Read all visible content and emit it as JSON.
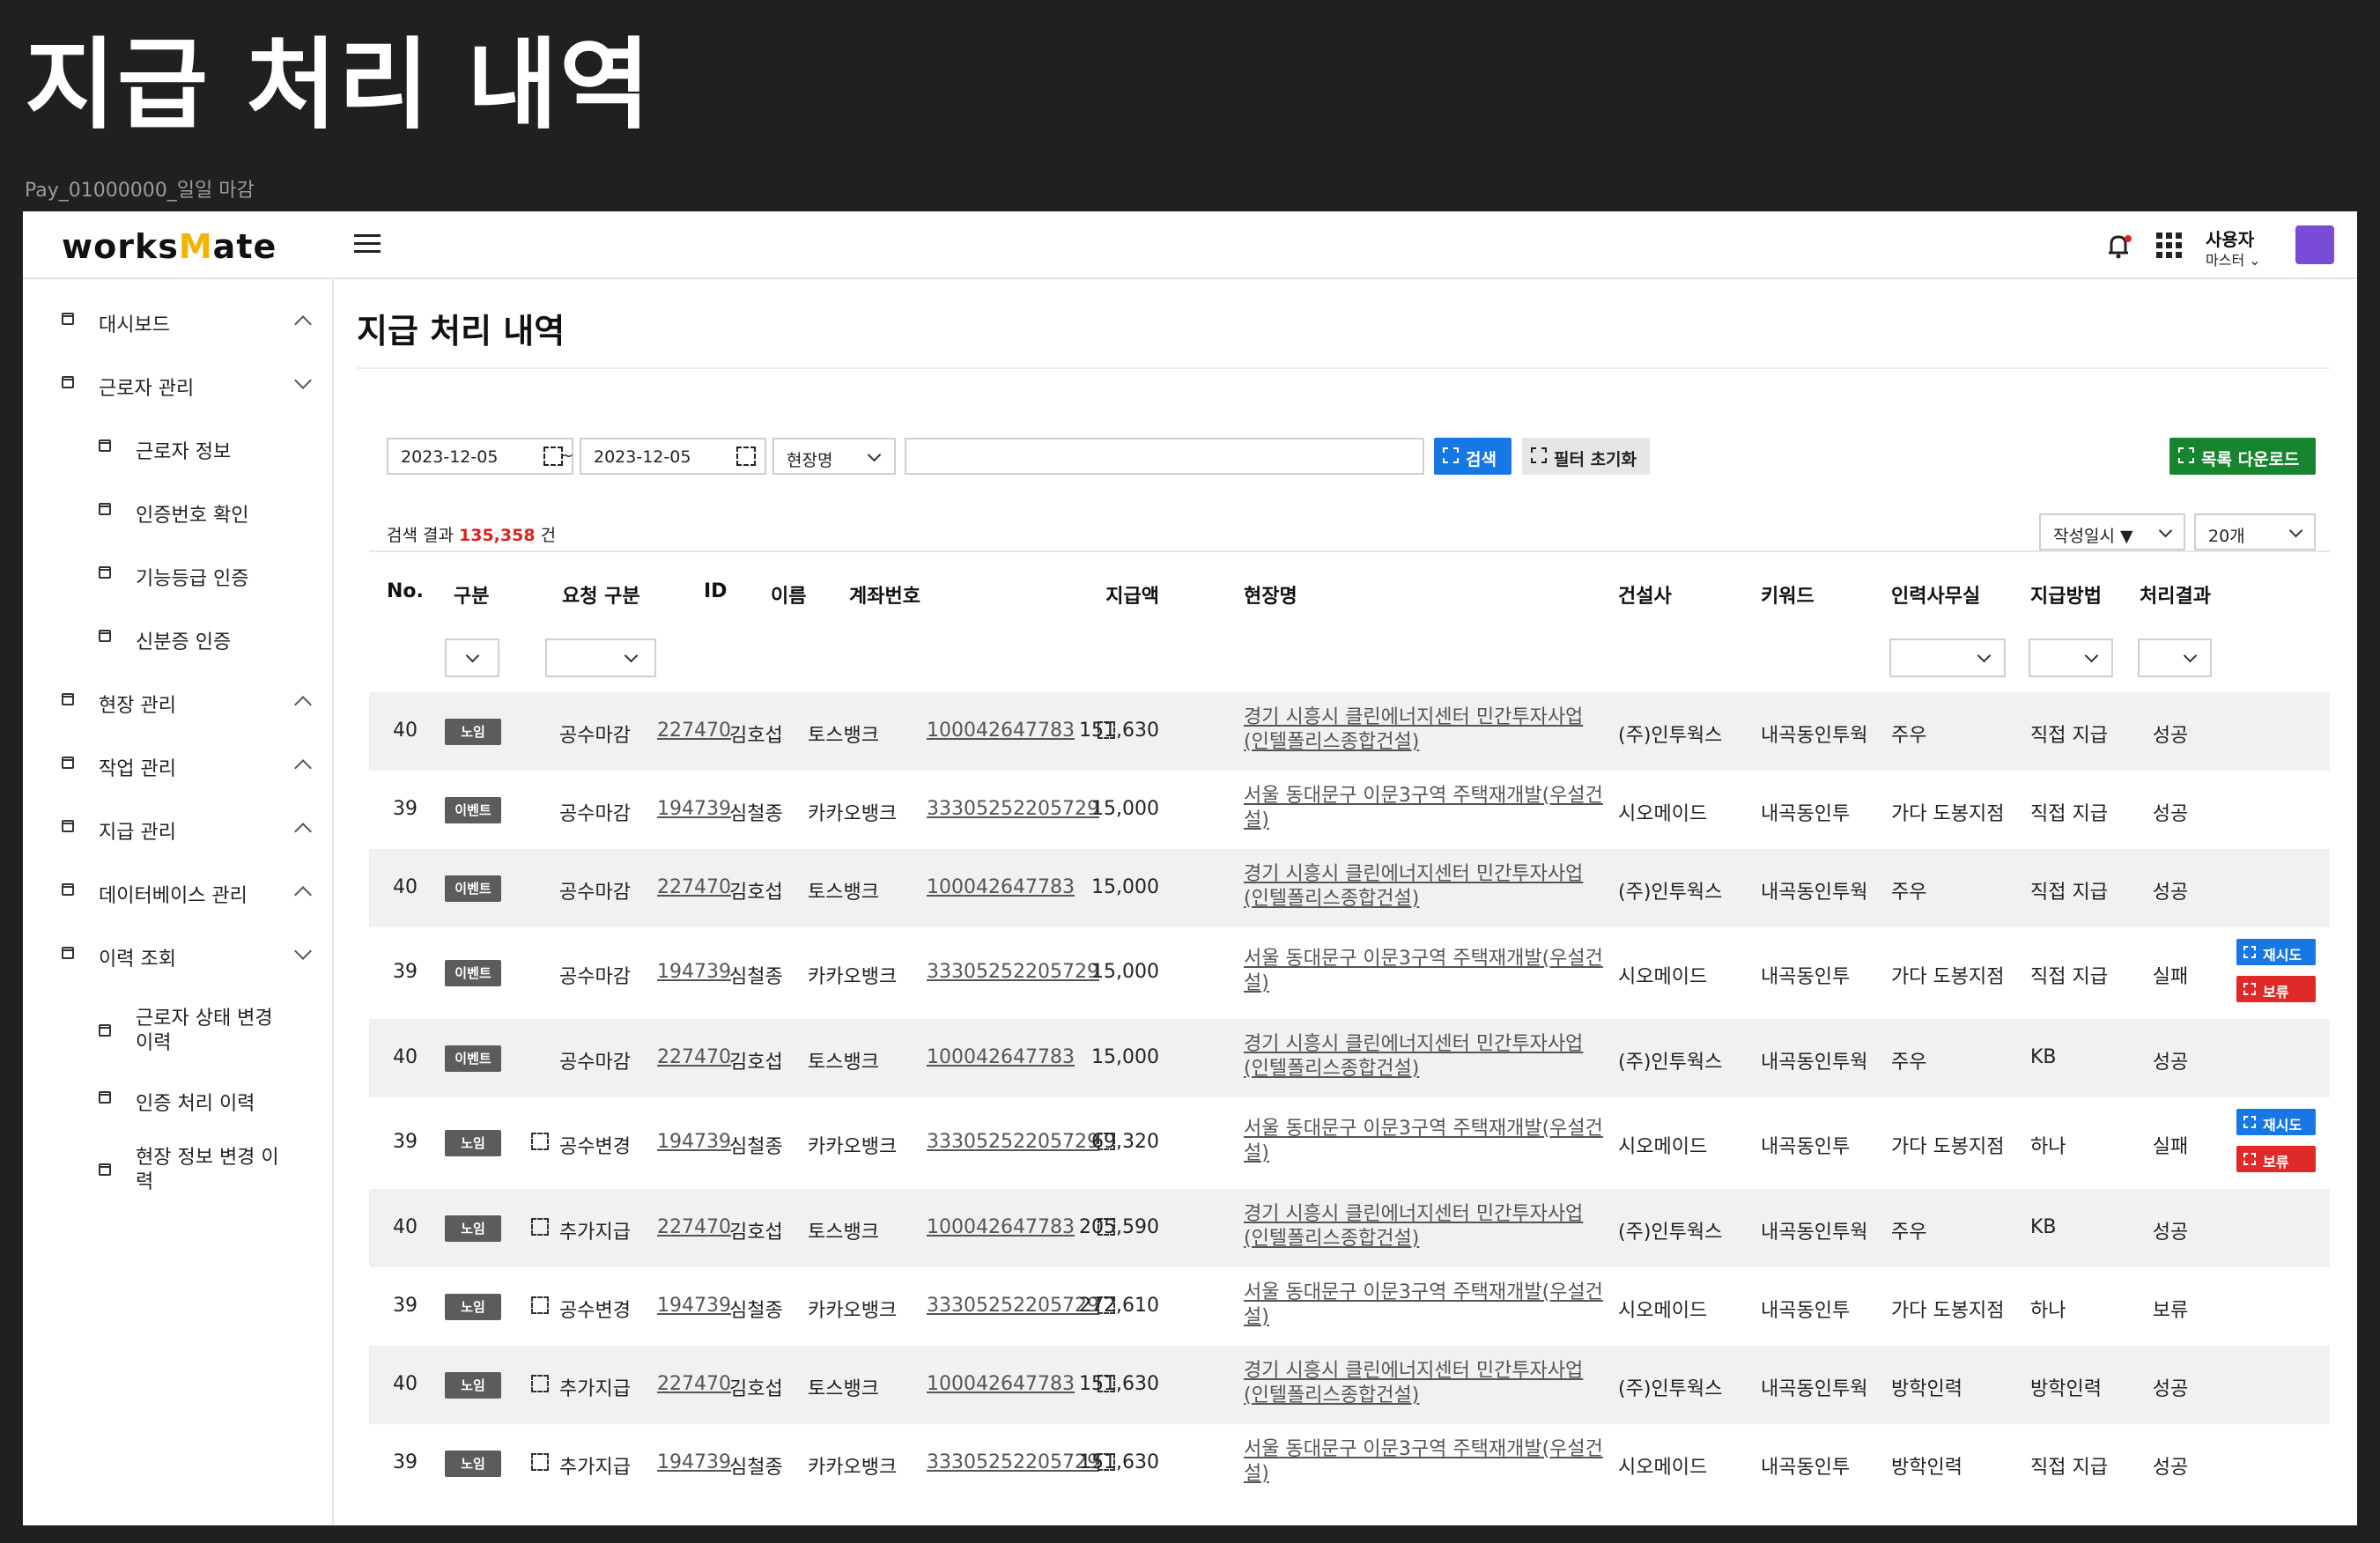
{
  "frame": {
    "title": "지급 처리 내역",
    "screen_id": "Pay_01000000_일일 마감"
  },
  "header": {
    "logo_prefix": "works",
    "logo_mark": "M",
    "logo_suffix": "ate",
    "user_name": "사용자",
    "user_role": "마스터 ⌄"
  },
  "sidebar": {
    "items": [
      {
        "label": "대시보드"
      },
      {
        "label": "근로자 관리"
      },
      {
        "label": "근로자 정보"
      },
      {
        "label": "인증번호 확인"
      },
      {
        "label": "기능등급 인증"
      },
      {
        "label": "신분증 인증"
      },
      {
        "label": "현장 관리"
      },
      {
        "label": "작업 관리"
      },
      {
        "label": "지급 관리"
      },
      {
        "label": "데이터베이스 관리"
      },
      {
        "label": "이력 조회"
      },
      {
        "label": "근로자 상태 변경 이력"
      },
      {
        "label": "인증 처리 이력"
      },
      {
        "label": "현장 정보 변경 이력"
      }
    ]
  },
  "main": {
    "title": "지급 처리 내역",
    "filters": {
      "date_from": "2023-12-05",
      "date_separator": "~",
      "date_to": "2023-12-05",
      "search_field": "현장명",
      "search_text": "",
      "search_label": "검색",
      "reset_label": "필터 초기화",
      "download_label": "목록 다운로드"
    },
    "result": {
      "prefix": "검색 결과",
      "count": "135,358",
      "suffix": "건"
    },
    "sort": {
      "selected": "작성일시 ▼",
      "page_size": "20개"
    },
    "columns": [
      "No.",
      "구분",
      "요청 구분",
      "ID",
      "이름",
      "계좌번호",
      "지급액",
      "현장명",
      "건설사",
      "키워드",
      "인력사무실",
      "지급방법",
      "처리결과"
    ],
    "rows": [
      {
        "no": "40",
        "type": "노임",
        "req": "공수마감",
        "req_icon": false,
        "id": "227470",
        "name": "김호섭",
        "bank": "토스뱅크",
        "account": "100042647783",
        "amount_icon": true,
        "amount": "151,630",
        "site": "경기 시흥시 클린에너지센터 민간투자사업(인텔폴리스종합건설)",
        "builder": "(주)인투웍스",
        "keyword": "내곡동인투웍",
        "office": "주우",
        "method": "직접 지급",
        "result": "성공"
      },
      {
        "no": "39",
        "type": "이벤트",
        "req": "공수마감",
        "req_icon": false,
        "id": "194739",
        "name": "심철종",
        "bank": "카카오뱅크",
        "account": "33305252205729",
        "amount_icon": false,
        "amount": "15,000",
        "site": "서울 동대문구 이문3구역 주택재개발(우설건설)",
        "builder": "시오메이드",
        "keyword": "내곡동인투",
        "office": "가다 도봉지점",
        "method": "직접 지급",
        "result": "성공"
      },
      {
        "no": "40",
        "type": "이벤트",
        "req": "공수마감",
        "req_icon": false,
        "id": "227470",
        "name": "김호섭",
        "bank": "토스뱅크",
        "account": "100042647783",
        "amount_icon": false,
        "amount": "15,000",
        "site": "경기 시흥시 클린에너지센터 민간투자사업(인텔폴리스종합건설)",
        "builder": "(주)인투웍스",
        "keyword": "내곡동인투웍",
        "office": "주우",
        "method": "직접 지급",
        "result": "성공"
      },
      {
        "no": "39",
        "type": "이벤트",
        "req": "공수마감",
        "req_icon": false,
        "id": "194739",
        "name": "심철종",
        "bank": "카카오뱅크",
        "account": "33305252205729",
        "amount_icon": false,
        "amount": "15,000",
        "site": "서울 동대문구 이문3구역 주택재개발(우설건설)",
        "builder": "시오메이드",
        "keyword": "내곡동인투",
        "office": "가다 도봉지점",
        "method": "직접 지급",
        "result": "실패",
        "actions": [
          "재시도",
          "보류"
        ]
      },
      {
        "no": "40",
        "type": "이벤트",
        "req": "공수마감",
        "req_icon": false,
        "id": "227470",
        "name": "김호섭",
        "bank": "토스뱅크",
        "account": "100042647783",
        "amount_icon": false,
        "amount": "15,000",
        "site": "경기 시흥시 클린에너지센터 민간투자사업(인텔폴리스종합건설)",
        "builder": "(주)인투웍스",
        "keyword": "내곡동인투웍",
        "office": "주우",
        "method": "KB",
        "result": "성공"
      },
      {
        "no": "39",
        "type": "노임",
        "req": "공수변경",
        "req_icon": true,
        "id": "194739",
        "name": "심철종",
        "bank": "카카오뱅크",
        "account": "33305252205729",
        "amount_icon": true,
        "amount": "69,320",
        "site": "서울 동대문구 이문3구역 주택재개발(우설건설)",
        "builder": "시오메이드",
        "keyword": "내곡동인투",
        "office": "가다 도봉지점",
        "method": "하나",
        "result": "실패",
        "actions": [
          "재시도",
          "보류"
        ]
      },
      {
        "no": "40",
        "type": "노임",
        "req": "추가지급",
        "req_icon": true,
        "id": "227470",
        "name": "김호섭",
        "bank": "토스뱅크",
        "account": "100042647783",
        "amount_icon": true,
        "amount": "205,590",
        "site": "경기 시흥시 클린에너지센터 민간투자사업(인텔폴리스종합건설)",
        "builder": "(주)인투웍스",
        "keyword": "내곡동인투웍",
        "office": "주우",
        "method": "KB",
        "result": "성공"
      },
      {
        "no": "39",
        "type": "노임",
        "req": "공수변경",
        "req_icon": true,
        "id": "194739",
        "name": "심철종",
        "bank": "카카오뱅크",
        "account": "33305252205729",
        "amount_icon": true,
        "amount": "272,610",
        "site": "서울 동대문구 이문3구역 주택재개발(우설건설)",
        "builder": "시오메이드",
        "keyword": "내곡동인투",
        "office": "가다 도봉지점",
        "method": "하나",
        "result": "보류"
      },
      {
        "no": "40",
        "type": "노임",
        "req": "추가지급",
        "req_icon": true,
        "id": "227470",
        "name": "김호섭",
        "bank": "토스뱅크",
        "account": "100042647783",
        "amount_icon": true,
        "amount": "151,630",
        "site": "경기 시흥시 클린에너지센터 민간투자사업(인텔폴리스종합건설)",
        "builder": "(주)인투웍스",
        "keyword": "내곡동인투웍",
        "office": "방학인력",
        "method": "방학인력",
        "result": "성공"
      },
      {
        "no": "39",
        "type": "노임",
        "req": "추가지급",
        "req_icon": true,
        "id": "194739",
        "name": "심철종",
        "bank": "카카오뱅크",
        "account": "33305252205729",
        "amount_icon": true,
        "amount": "151,630",
        "site": "서울 동대문구 이문3구역 주택재개발(우설건설)",
        "builder": "시오메이드",
        "keyword": "내곡동인투",
        "office": "방학인력",
        "method": "직접 지급",
        "result": "성공"
      }
    ]
  }
}
